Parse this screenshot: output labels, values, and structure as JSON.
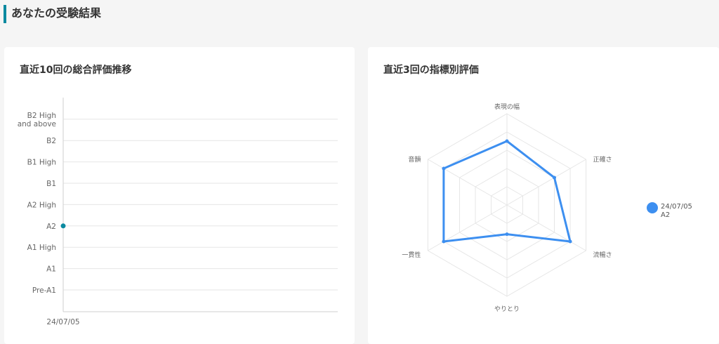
{
  "page": {
    "title": "あなたの受験結果"
  },
  "colors": {
    "accent": "#0b8aa0",
    "line_point": "#0b8aa0",
    "radar_series": "#3d8ff0",
    "grid": "#e6e6e6",
    "axis_label": "#666666"
  },
  "trend": {
    "title": "直近10回の総合評価推移"
  },
  "radar": {
    "title": "直近3回の指標別評価"
  },
  "chart_data": [
    {
      "type": "line",
      "title": "直近10回の総合評価推移",
      "y_categories": [
        "Pre-A1",
        "A1",
        "A1 High",
        "A2",
        "A2 High",
        "B1",
        "B1 High",
        "B2",
        "B2 High and above"
      ],
      "x": [
        "24/07/05"
      ],
      "series": [
        {
          "values": [
            "A2"
          ]
        }
      ],
      "grid": true
    },
    {
      "type": "radar",
      "title": "直近3回の指標別評価",
      "axes": [
        "表現の幅",
        "正確さ",
        "流暢さ",
        "やりとり",
        "一貫性",
        "音韻"
      ],
      "levels": 5,
      "max": 5,
      "series": [
        {
          "name_line1": "24/07/05",
          "name_line2": "A2",
          "values": [
            3.5,
            3,
            4,
            1.6,
            4,
            4
          ]
        }
      ],
      "legend_position": "right"
    }
  ]
}
